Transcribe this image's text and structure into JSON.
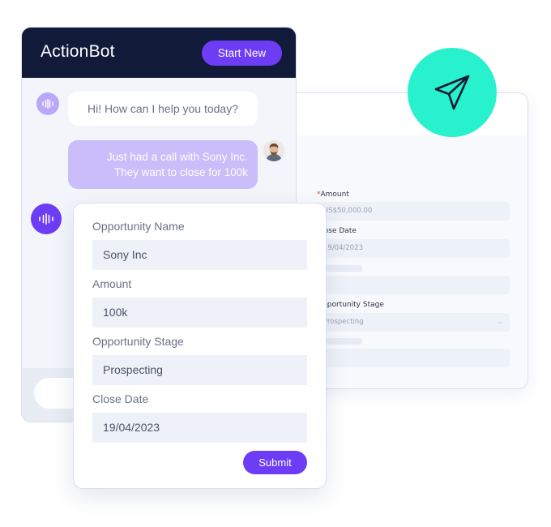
{
  "colors": {
    "header_bg": "#121a3a",
    "accent": "#6d3df5",
    "user_bubble": "#c9bdfa",
    "send_badge": "#27f2cd",
    "required_star": "#e0413e"
  },
  "crm_form": {
    "amount_required": "*",
    "amount_label": "Amount",
    "amount_value": "US$50,000.00",
    "close_date_label": "Close Date",
    "close_date_value": "19/04/2023",
    "stage_label": "Opportunity Stage",
    "stage_value": "Prospecting",
    "chevron_icon": "chevron-down-icon"
  },
  "chat": {
    "title": "ActionBot",
    "start_new_label": "Start New",
    "bot_message": "Hi! How can I help you today?",
    "user_message_line1": "Just had a call with Sony Inc.",
    "user_message_line2": "They want to close for 100k",
    "bot_icon": "sound-wave-icon",
    "user_avatar": "user-avatar"
  },
  "opportunity_form": {
    "name_label": "Opportunity Name",
    "name_value": "Sony Inc",
    "amount_label": "Amount",
    "amount_value": "100k",
    "stage_label": "Opportunity Stage",
    "stage_value": "Prospecting",
    "close_date_label": "Close Date",
    "close_date_value": "19/04/2023",
    "submit_label": "Submit"
  },
  "badge": {
    "icon": "paper-plane-icon"
  }
}
